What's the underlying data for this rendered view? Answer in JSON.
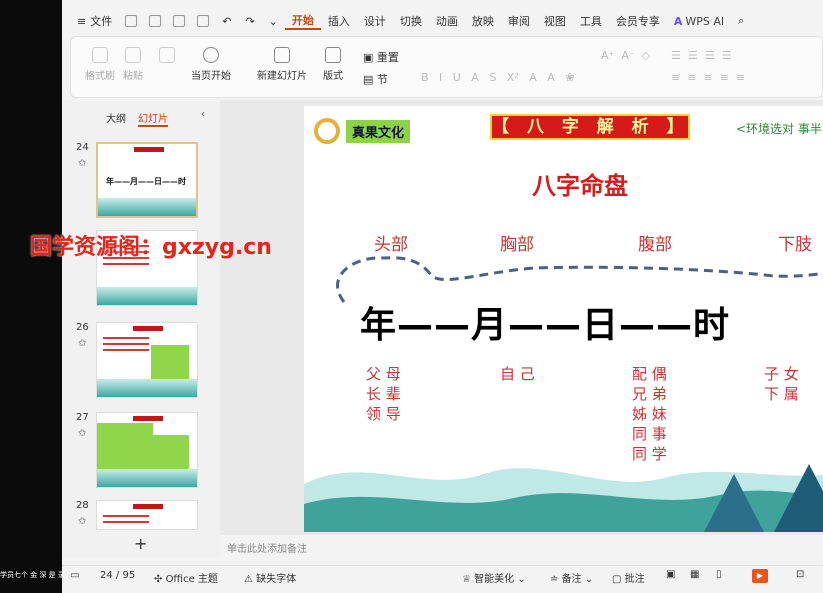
{
  "menu": {
    "file": "文件",
    "tabs": [
      "开始",
      "插入",
      "设计",
      "切换",
      "动画",
      "放映",
      "审阅",
      "视图",
      "工具",
      "会员专享"
    ],
    "active_tab": "开始",
    "wps_ai": "WPS AI"
  },
  "ribbon": {
    "format_painter": "格式刷",
    "paste": "粘贴",
    "play_from_current": "当页开始",
    "new_slide": "新建幻灯片",
    "layout": "版式",
    "reset": "重置",
    "section": "节"
  },
  "panel": {
    "tab_outline": "大纲",
    "tab_slides": "幻灯片",
    "slides": [
      {
        "num": "24",
        "big": "年——月——日——时"
      },
      {
        "num": "",
        "big": ""
      },
      {
        "num": "26",
        "big": ""
      },
      {
        "num": "27",
        "big": ""
      },
      {
        "num": "28",
        "big": ""
      }
    ],
    "add": "+"
  },
  "slide": {
    "brand": "真果文化",
    "banner": "【 八 字 解 析 】",
    "top_right": "<环境选对  事半",
    "title": "八字命盘",
    "parts": [
      "头部",
      "胸部",
      "腹部",
      "下肢"
    ],
    "pillars": "年——月——日——时",
    "relations": {
      "year": [
        "父 母",
        "长 辈",
        "领 导"
      ],
      "month": [
        "自 己"
      ],
      "day": [
        "配 偶",
        "兄 弟",
        "姊 妹",
        "同 事",
        "同 学"
      ],
      "hour": [
        "子 女",
        "下 属"
      ]
    }
  },
  "notes_placeholder": "单击此处添加备注",
  "watermark": "国学资源阁：gxzyg.cn",
  "status": {
    "page": "24 / 95",
    "theme": "Office 主题",
    "missing_font": "缺失字体",
    "smart_beautify": "智能美化",
    "notes": "备注",
    "comments": "批注"
  },
  "taskbar": "学员七个 金 深 是 录",
  "colors": {
    "accent": "#c24b1a",
    "red": "#d41c1c",
    "banner_gold": "#f7d23a",
    "brand_green": "#8cd34a"
  }
}
